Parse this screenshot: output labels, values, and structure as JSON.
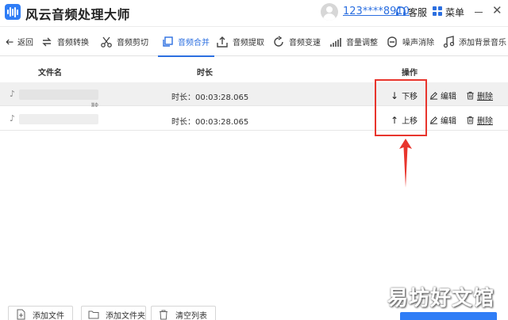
{
  "app": {
    "title": "风云音频处理大师",
    "user_id": "123****8910",
    "service_label": "客服",
    "menu_label": "菜单"
  },
  "toolbar": {
    "back": "返回",
    "items": [
      {
        "label": "音频转换",
        "icon": "convert-icon"
      },
      {
        "label": "音频剪切",
        "icon": "scissors-icon"
      },
      {
        "label": "音频合并",
        "icon": "merge-icon",
        "active": true
      },
      {
        "label": "音频提取",
        "icon": "extract-icon"
      },
      {
        "label": "音频变速",
        "icon": "speed-icon"
      },
      {
        "label": "音量调整",
        "icon": "volume-bars-icon"
      },
      {
        "label": "噪声消除",
        "icon": "noise-icon"
      },
      {
        "label": "添加背景音乐",
        "icon": "music-note-icon"
      }
    ],
    "accent": "#2c6fe0"
  },
  "table": {
    "columns": [
      "文件名",
      "时长",
      "操作"
    ],
    "rows": [
      {
        "duration": "时长：00:03:28.065",
        "move_label": "下移",
        "move_arrow": "↓",
        "edit_label": "编辑",
        "delete_label": "删除"
      },
      {
        "duration": "时长：00:03:28.065",
        "move_label": "上移",
        "move_arrow": "↑",
        "edit_label": "编辑",
        "delete_label": "删除"
      }
    ]
  },
  "bottom": {
    "add_file": "添加文件",
    "add_folder": "添加文件夹",
    "clear_list": "清空列表"
  },
  "watermark": "易坊好文馆",
  "annotation_color": "#e8352d"
}
